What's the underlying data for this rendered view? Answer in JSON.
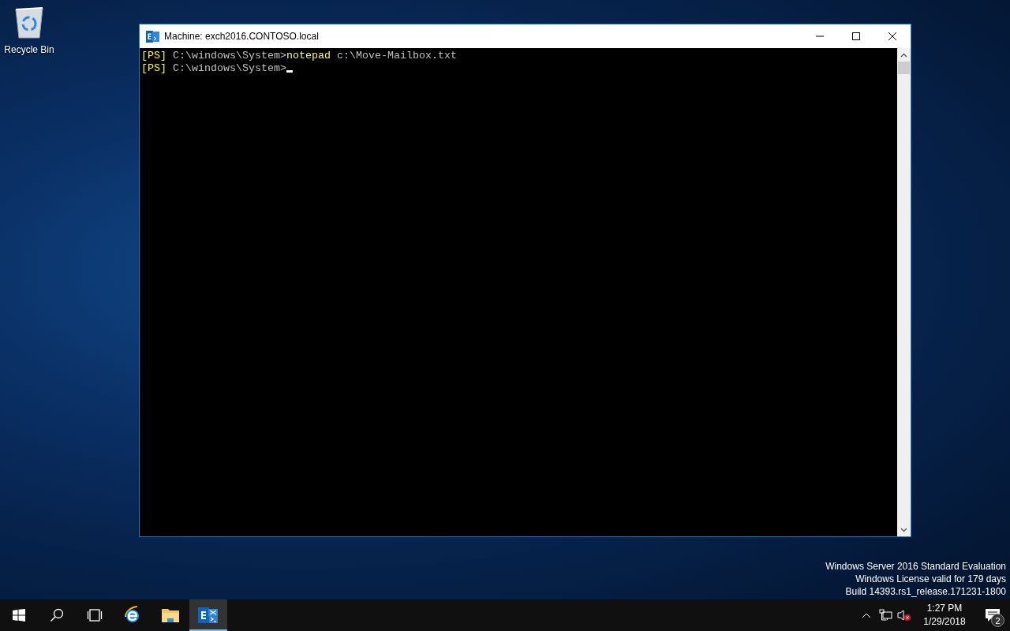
{
  "desktop_icons": [
    {
      "label": "Recycle Bin"
    }
  ],
  "window": {
    "title": "Machine: exch2016.CONTOSO.local",
    "focused": true,
    "lines": [
      {
        "cursor": false,
        "segments": [
          {
            "kind": "prompt",
            "text": "[PS]"
          },
          {
            "kind": "path",
            "text": " C:\\windows\\System>"
          },
          {
            "kind": "command",
            "text": "notepad"
          },
          {
            "kind": "argument",
            "text": " c:\\Move-Mailbox.txt"
          }
        ]
      },
      {
        "cursor": true,
        "segments": [
          {
            "kind": "prompt",
            "text": "[PS]"
          },
          {
            "kind": "path",
            "text": " C:\\windows\\System>"
          }
        ]
      }
    ]
  },
  "watermark_lines": [
    "Windows Server 2016 Standard Evaluation",
    "Windows License valid for 179 days",
    "Build 14393.rs1_release.171231-1800"
  ],
  "taskbar": {
    "apps": [
      {
        "kind": "start",
        "selected": false
      },
      {
        "kind": "search",
        "selected": false
      },
      {
        "kind": "taskview",
        "selected": false
      },
      {
        "kind": "browser",
        "selected": false
      },
      {
        "kind": "explorer",
        "selected": false
      },
      {
        "kind": "shell",
        "selected": true
      }
    ],
    "clock": {
      "time": "1:27 PM",
      "date": "1/29/2018"
    },
    "notifications": {
      "count": "2"
    },
    "volume_muted": true
  }
}
